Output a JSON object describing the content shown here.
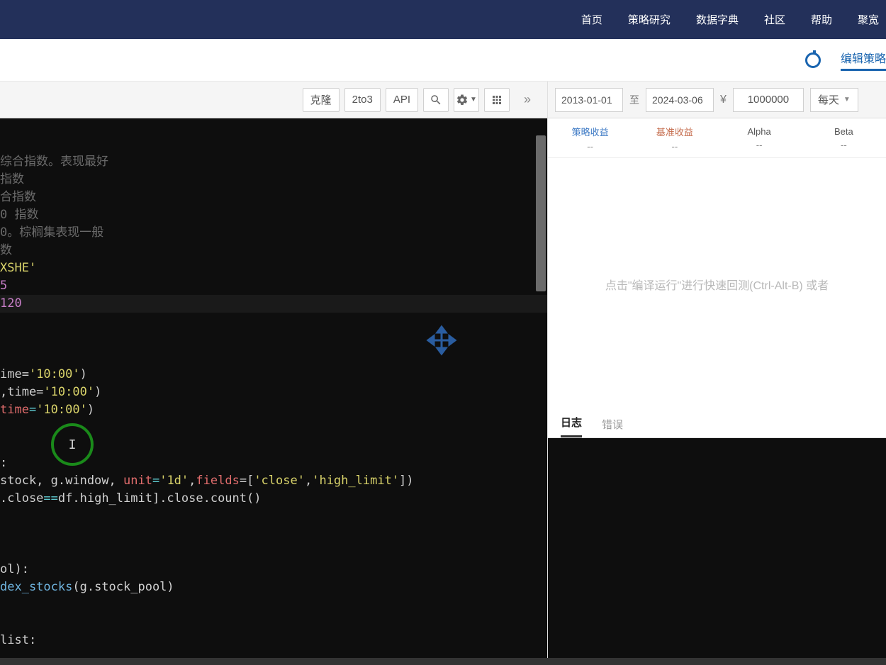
{
  "nav": {
    "items": [
      "首页",
      "策略研究",
      "数据字典",
      "社区",
      "帮助",
      "聚宽"
    ]
  },
  "subbar": {
    "label": "编辑策略"
  },
  "edtoolbar": {
    "clone": "克隆",
    "to3": "2to3",
    "api": "API"
  },
  "code": {
    "l1": "综合指数。表现最好",
    "l2": "指数",
    "l3": "合指数",
    "l4": "0 指数",
    "l5": "0。棕榈集表现一般",
    "l6": "数",
    "l7": "XSHE'",
    "l8": "5",
    "l9": "120",
    "l10a": "ime=",
    "l10b": "'10:00'",
    "l10c": ")",
    "l11a": ",time=",
    "l11b": "'10:00'",
    "l11c": ")",
    "l12a": "time",
    "l12b": "=",
    "l12c": "'10:00'",
    "l12d": ")",
    "l13a": ":",
    "l14a": "stock, g.window, ",
    "l14b": "unit",
    "l14c": "=",
    "l14d": "'1d'",
    "l14e": ",",
    "l14f": "fields",
    "l14g": "=[",
    "l14h": "'close'",
    "l14i": ",",
    "l14j": "'high_limit'",
    "l14k": "])",
    "l15a": ".close",
    "l15b": "==",
    "l15c": "df.high_limit].close.count()",
    "l16a": "ol):",
    "l17a": "dex_stocks",
    "l17b": "(g.stock_pool)",
    "l18a": "list:"
  },
  "rctrl": {
    "date_from": "2013-01-01",
    "to": "至",
    "date_to": "2024-03-06",
    "currency": "¥",
    "amount": "1000000",
    "freq": "每天"
  },
  "metrics": {
    "m1": {
      "label": "策略收益",
      "value": "--"
    },
    "m2": {
      "label": "基准收益",
      "value": "--"
    },
    "m3": {
      "label": "Alpha",
      "value": "--"
    },
    "m4": {
      "label": "Beta",
      "value": "--"
    }
  },
  "hint": "点击\"编译运行\"进行快速回测(Ctrl-Alt-B) 或者",
  "logtabs": {
    "log": "日志",
    "err": "错误"
  }
}
